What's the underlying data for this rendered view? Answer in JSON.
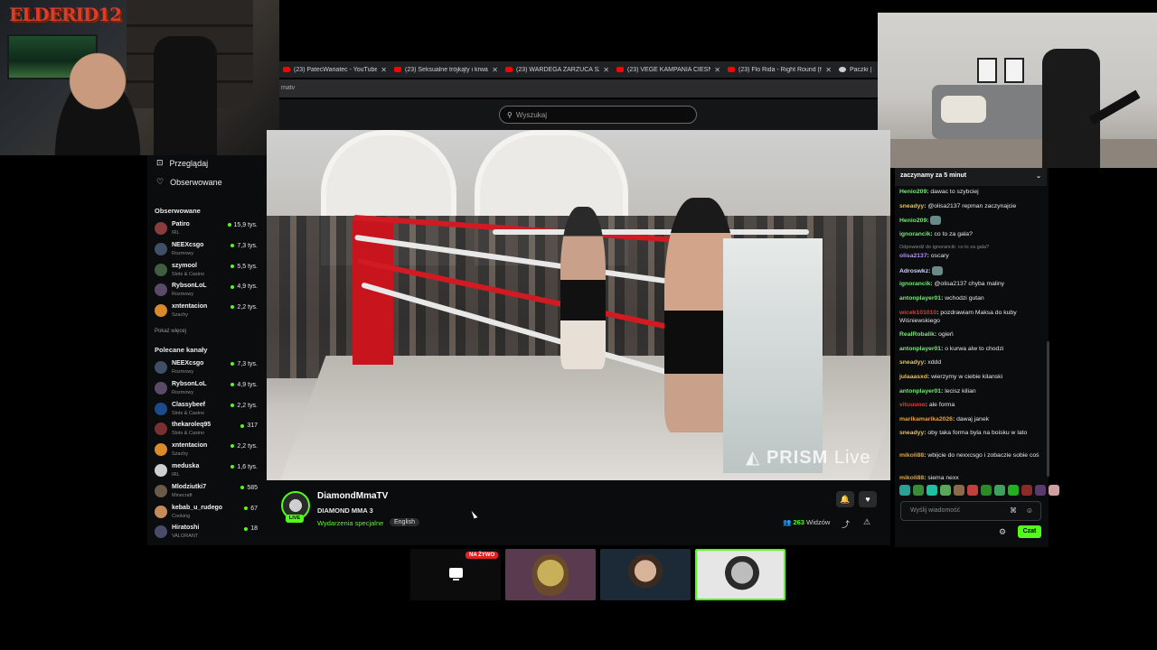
{
  "overlay": {
    "logo_main": "ELDER",
    "logo_accent": "ID12"
  },
  "browser": {
    "tabs": [
      {
        "label": "(23) PatecWariatec - YouTube"
      },
      {
        "label": "(23) Seksualne trójkąty i krwaw"
      },
      {
        "label": "(23) WARDEGA ZARZUCA SZAJ"
      },
      {
        "label": "(23) VEGE KAMPANIA CIEŚNIEN"
      },
      {
        "label": "(23) Flo Rida - Right Round (fe"
      },
      {
        "label": "Paczki | Foo"
      }
    ],
    "url_fragment": "matv"
  },
  "search": {
    "placeholder": "Wyszukaj"
  },
  "sidebar": {
    "nav": [
      {
        "label": "Przeglądaj",
        "icon": "compass-icon"
      },
      {
        "label": "Obserwowane",
        "icon": "heart-icon"
      }
    ],
    "followed_title": "Obserwowane",
    "followed": [
      {
        "name": "Patiro",
        "category": "IRL",
        "viewers": "15,9 tys.",
        "color": "#8a3b3b"
      },
      {
        "name": "NEEXcsgo",
        "category": "Rozmowy",
        "viewers": "7,3 tys.",
        "color": "#3f4f66"
      },
      {
        "name": "szymool",
        "category": "Slots & Casino",
        "viewers": "5,5 tys.",
        "color": "#3f5f3f"
      },
      {
        "name": "RybsonLoL",
        "category": "Rozmowy",
        "viewers": "4,9 tys.",
        "color": "#5a4a6a"
      },
      {
        "name": "xntentacion",
        "category": "Szachy",
        "viewers": "2,2 tys.",
        "color": "#d98a2a"
      }
    ],
    "show_more": "Pokaż więcej",
    "recommended_title": "Polecane kanały",
    "recommended": [
      {
        "name": "NEEXcsgo",
        "category": "Rozmowy",
        "viewers": "7,3 tys.",
        "color": "#3f4f66"
      },
      {
        "name": "RybsonLoL",
        "category": "Rozmowy",
        "viewers": "4,9 tys.",
        "color": "#5a4a6a"
      },
      {
        "name": "Classybeef",
        "category": "Slots & Casino",
        "viewers": "2,2 tys.",
        "color": "#1d4a8a"
      },
      {
        "name": "thekaroleq95",
        "category": "Slots & Casino",
        "viewers": "317",
        "color": "#7a3030"
      },
      {
        "name": "xntentacion",
        "category": "Szachy",
        "viewers": "2,2 tys.",
        "color": "#d98a2a"
      },
      {
        "name": "meduska",
        "category": "IRL",
        "viewers": "1,6 tys.",
        "color": "#cfcfcf"
      },
      {
        "name": "Mlodziutki7",
        "category": "Minecraft",
        "viewers": "585",
        "color": "#6a5a4a"
      },
      {
        "name": "kebab_u_rudego",
        "category": "Cooking",
        "viewers": "67",
        "color": "#c98a5a"
      },
      {
        "name": "Hiratoshi",
        "category": "VALORANT",
        "viewers": "18",
        "color": "#4a4a6a"
      }
    ]
  },
  "stream": {
    "channel": "DiamondMmaTV",
    "live_badge": "LIVE",
    "title": "DIAMOND MMA 3",
    "category": "Wydarzenia specjalne",
    "language": "English",
    "viewers_count": "263",
    "viewers_label": "Widzów",
    "watermark_main": "PRISM",
    "watermark_sub": "Live"
  },
  "chat": {
    "pinned": "zaczynamy za 5 minut",
    "messages": [
      {
        "user": "Henio209",
        "color": "#7ee07e",
        "text": "dawac to szybciej"
      },
      {
        "user": "sneadyy",
        "color": "#f0c040",
        "text": "@olisa2137 repman zaczynajcie"
      },
      {
        "user": "Henio209",
        "color": "#7ee07e",
        "text": ""
      },
      {
        "user": "ignorancik",
        "color": "#7ee07e",
        "text": "co to za gala?"
      },
      {
        "user": "olisa2137",
        "color": "#b58cff",
        "text": "oscary",
        "reply": "Odpowiedź do ignorancik: co to za gala?"
      },
      {
        "user": "Adroswkz",
        "color": "#d0d0ff",
        "text": ""
      },
      {
        "user": "ignorancik",
        "color": "#7ee07e",
        "text": "@olisa2137 chyba maliny"
      },
      {
        "user": "antonplayer01",
        "color": "#7ee07e",
        "text": "wchodzi gutan"
      },
      {
        "user": "wicek101010",
        "color": "#e03a3a",
        "text": "pozdrawiam Maksa do kuby Wiśniewskiego"
      },
      {
        "user": "RealRobalik",
        "color": "#7ee07e",
        "text": "ogień"
      },
      {
        "user": "antonplayer01",
        "color": "#7ee07e",
        "text": "o kurwa alw to chodzi"
      },
      {
        "user": "sneadyy",
        "color": "#f0c040",
        "text": "xddd"
      },
      {
        "user": "julaaasxd",
        "color": "#f0c040",
        "text": "wierzymy w ciebie kilanski"
      },
      {
        "user": "antonplayer01",
        "color": "#7ee07e",
        "text": "lecisz kilian"
      },
      {
        "user": "vituuuoo",
        "color": "#e03a3a",
        "text": "ale forma"
      },
      {
        "user": "marikamarika2026",
        "color": "#f0a030",
        "text": "dawaj janek"
      },
      {
        "user": "sneadyy",
        "color": "#f0c040",
        "text": "oby taka forma byla na boisku w lato"
      },
      {
        "user": "mikoli88",
        "color": "#f0a030",
        "text": "wbijcie do nexxcsgo i zobaczie sobie coś"
      },
      {
        "user": "mikoli88",
        "color": "#f0a030",
        "text": "siema nexx"
      }
    ],
    "emotes": [
      "#2aa198",
      "#3a8a3a",
      "#20c0a0",
      "#58a858",
      "#8a6a4a",
      "#c04040",
      "#2a8a2a",
      "#40a060",
      "#20b020",
      "#8a2a2a",
      "#5a3a6a",
      "#d0a0a0"
    ],
    "input_placeholder": "Wyślij wiadomość",
    "send_label": "Czat"
  },
  "bottom_tiles": {
    "live_tag": "NA ŻYWO"
  }
}
